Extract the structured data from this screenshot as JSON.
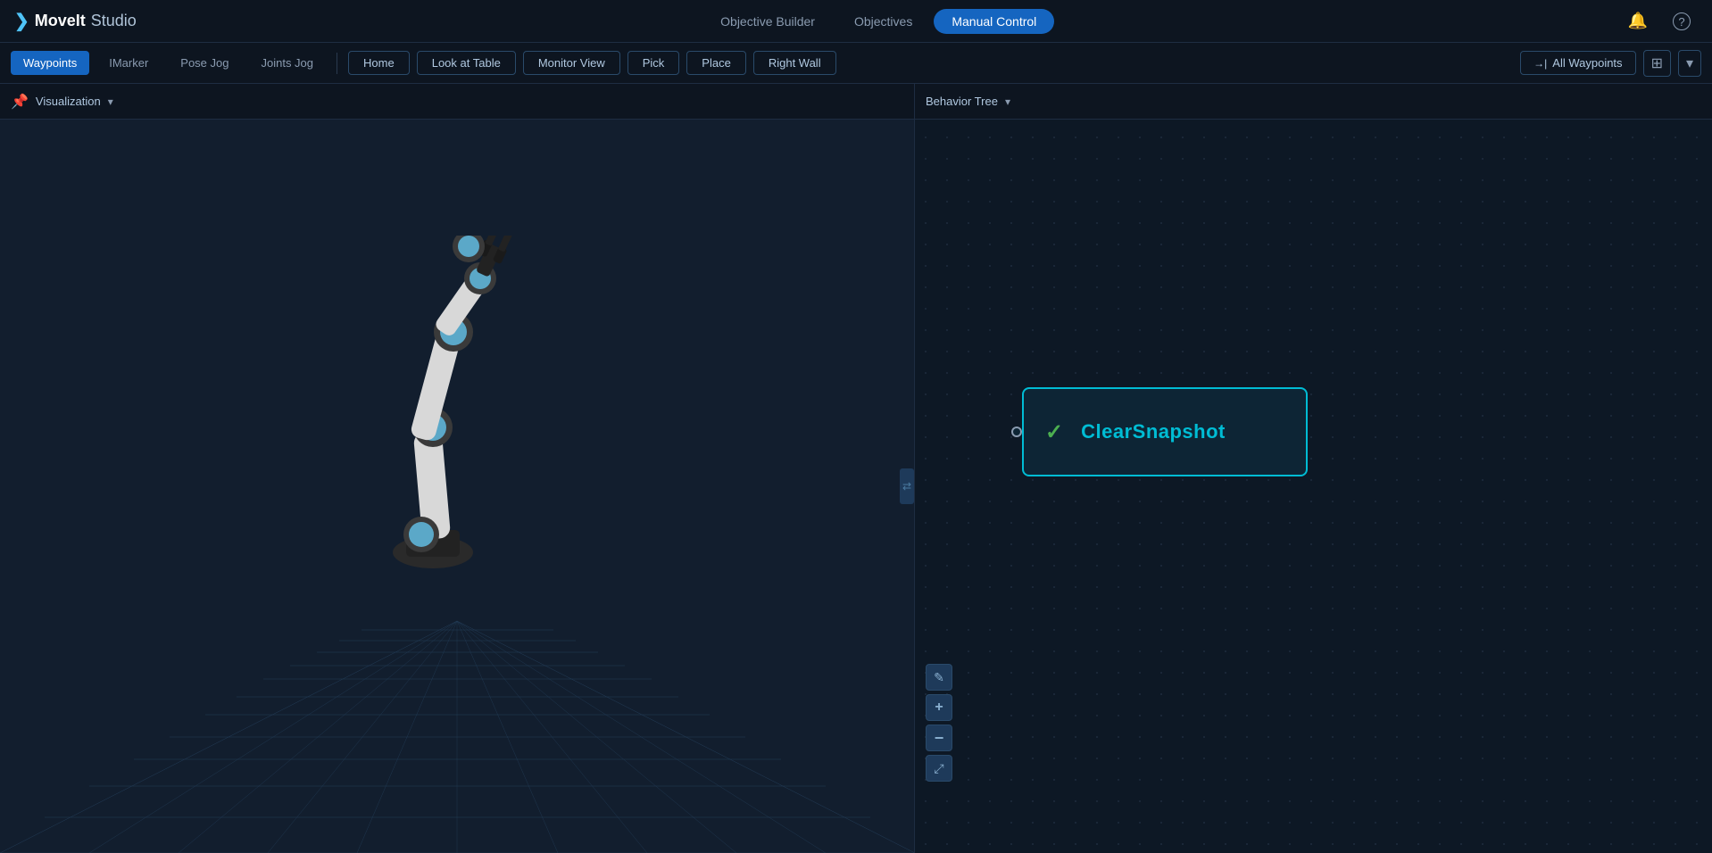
{
  "app": {
    "name": "MoveIt",
    "studio": "Studio",
    "logo_arrow": "❯"
  },
  "nav": {
    "center_items": [
      {
        "id": "objective-builder",
        "label": "Objective Builder",
        "active": false
      },
      {
        "id": "objectives",
        "label": "Objectives",
        "active": false
      },
      {
        "id": "manual-control",
        "label": "Manual Control",
        "active": true
      }
    ],
    "right_icons": [
      {
        "id": "bell",
        "symbol": "🔔"
      },
      {
        "id": "help",
        "symbol": "?"
      }
    ]
  },
  "toolbar": {
    "tabs": [
      {
        "id": "waypoints",
        "label": "Waypoints",
        "active": true
      },
      {
        "id": "imarker",
        "label": "IMarker",
        "active": false
      },
      {
        "id": "pose-jog",
        "label": "Pose Jog",
        "active": false
      },
      {
        "id": "joints-jog",
        "label": "Joints Jog",
        "active": false
      }
    ],
    "waypoints": [
      {
        "id": "home",
        "label": "Home"
      },
      {
        "id": "look-at-table",
        "label": "Look at Table"
      },
      {
        "id": "monitor-view",
        "label": "Monitor View"
      },
      {
        "id": "pick",
        "label": "Pick"
      },
      {
        "id": "place",
        "label": "Place"
      },
      {
        "id": "right-wall",
        "label": "Right Wall"
      }
    ],
    "all_waypoints_label": "All Waypoints",
    "all_waypoints_icon": "→|"
  },
  "visualization": {
    "title": "Visualization",
    "panel_icon": "📌"
  },
  "behavior_tree": {
    "title": "Behavior Tree",
    "node": {
      "label": "ClearSnapshot",
      "status": "success",
      "check_symbol": "✓"
    }
  },
  "bt_tools": [
    {
      "id": "edit",
      "symbol": "✎"
    },
    {
      "id": "zoom-in",
      "symbol": "+"
    },
    {
      "id": "zoom-out",
      "symbol": "−"
    },
    {
      "id": "fit",
      "symbol": "⤢"
    }
  ],
  "colors": {
    "accent_blue": "#1565c0",
    "teal": "#00bcd4",
    "success_green": "#4caf50",
    "bg_dark": "#0d1520",
    "bg_panel": "#121e2e",
    "bg_right": "#0d1825",
    "border": "#1e2d42"
  }
}
